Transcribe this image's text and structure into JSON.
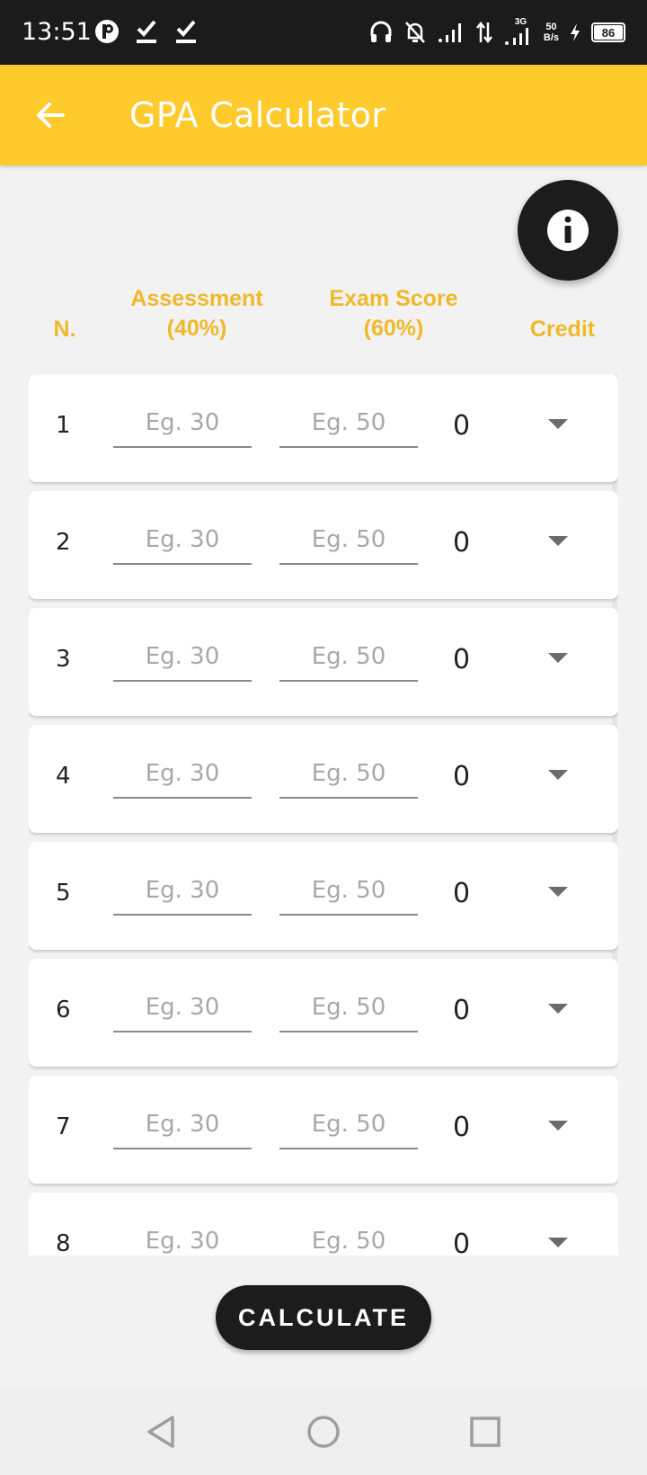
{
  "status_bar": {
    "time": "13:51",
    "network_type": "3G",
    "net_speed_value": "50",
    "net_speed_unit": "B/s",
    "battery": "86",
    "icons": [
      "app-indicator-icon",
      "checkmark-icon",
      "checkmark-icon",
      "headset-icon",
      "bell-off-icon",
      "signal-icon",
      "data-arrows-icon",
      "signal-3g-icon",
      "charging-icon",
      "battery-icon"
    ]
  },
  "app_bar": {
    "title": "GPA Calculator",
    "accent_color": "#ffca2c"
  },
  "headers": {
    "number": "N.",
    "assessment_line1": "Assessment",
    "assessment_line2": "(40%)",
    "exam_line1": "Exam Score",
    "exam_line2": "(60%)",
    "credit": "Credit",
    "header_color": "#f0b92a"
  },
  "rows": [
    {
      "number": "1",
      "assessment_placeholder": "Eg. 30",
      "exam_placeholder": "Eg. 50",
      "score": "0"
    },
    {
      "number": "2",
      "assessment_placeholder": "Eg. 30",
      "exam_placeholder": "Eg. 50",
      "score": "0"
    },
    {
      "number": "3",
      "assessment_placeholder": "Eg. 30",
      "exam_placeholder": "Eg. 50",
      "score": "0"
    },
    {
      "number": "4",
      "assessment_placeholder": "Eg. 30",
      "exam_placeholder": "Eg. 50",
      "score": "0"
    },
    {
      "number": "5",
      "assessment_placeholder": "Eg. 30",
      "exam_placeholder": "Eg. 50",
      "score": "0"
    },
    {
      "number": "6",
      "assessment_placeholder": "Eg. 30",
      "exam_placeholder": "Eg. 50",
      "score": "0"
    },
    {
      "number": "7",
      "assessment_placeholder": "Eg. 30",
      "exam_placeholder": "Eg. 50",
      "score": "0"
    },
    {
      "number": "8",
      "assessment_placeholder": "Eg. 30",
      "exam_placeholder": "Eg. 50",
      "score": "0"
    }
  ],
  "actions": {
    "calculate_label": "CALCULATE",
    "info_icon": "info-icon"
  },
  "navigation": {
    "icons": [
      "back-triangle-icon",
      "home-circle-icon",
      "recents-square-icon"
    ]
  }
}
